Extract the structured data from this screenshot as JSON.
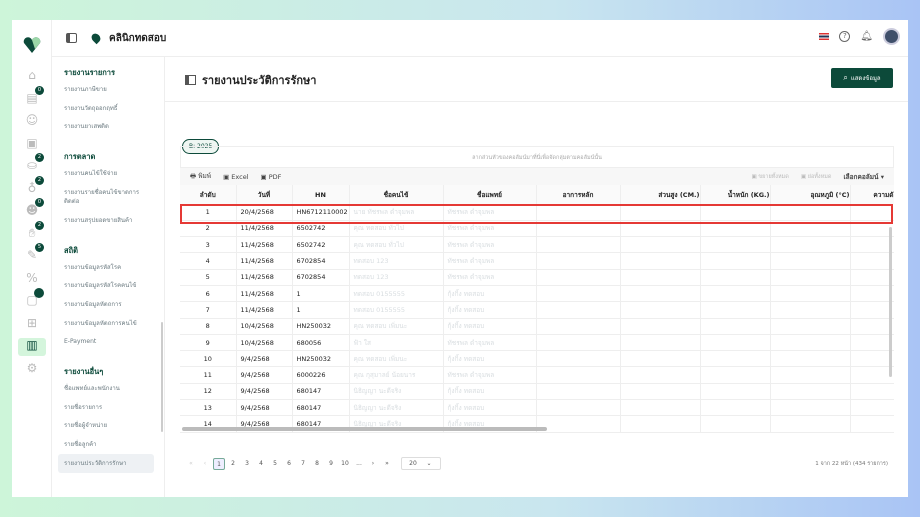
{
  "header": {
    "clinic_name": "คลินิกทดสอบ"
  },
  "rail": {
    "badges": [
      "0",
      "2",
      "2",
      "0",
      "2",
      "5"
    ]
  },
  "sidebar": {
    "groups": [
      {
        "title": "รายงานรายการ",
        "items": [
          "รายงานภาษีขาย",
          "รายงานวัตถุออกฤทธิ์",
          "รายงานยาเสพติด"
        ]
      },
      {
        "title": "การตลาด",
        "items": [
          "รายงานคนไข้ใช้จ่าย",
          "รายงานรายชื่อคนไข้ขาดการติดต่อ",
          "รายงานสรุปยอดขายสินค้า"
        ]
      },
      {
        "title": "สถิติ",
        "items": [
          "รายงานข้อมูลรหัสโรค",
          "รายงานข้อมูลรหัสโรคคนไข้",
          "รายงานข้อมูลหัตถการ",
          "รายงานข้อมูลหัตถการคนไข้",
          "E-Payment"
        ]
      },
      {
        "title": "รายงานอื่นๆ",
        "items": [
          "ชื่อแพทย์และพนักงาน",
          "รายชื่อรายการ",
          "รายชื่อผู้จำหน่าย",
          "รายชื่อลูกค้า",
          "รายงานประวัติการรักษา"
        ]
      }
    ]
  },
  "page": {
    "title": "รายงานประวัติการรักษา",
    "show_button": "แสดงข้อมูล",
    "filter_pill": "B: 2025",
    "group_hint": "ลากส่วนหัวของคอลัมน์มาที่นี่เพื่อจัดกลุ่มตามคอลัมน์นั้น"
  },
  "toolbar": {
    "print": "พิมพ์",
    "excel": "Excel",
    "pdf": "PDF",
    "expand_all": "ขยายทั้งหมด",
    "collapse_all": "ย่อทั้งหมด",
    "choose_columns": "เลือกคอลัมน์"
  },
  "table": {
    "columns": [
      "ลำดับ",
      "วันที่",
      "HN",
      "ชื่อคนไข้",
      "ชื่อแพทย์",
      "อาการหลัก",
      "ส่วนสูง (CM.)",
      "น้ำหนัก (KG.)",
      "อุณหภูมิ (°C)",
      "ความดั"
    ],
    "rows": [
      [
        "1",
        "20/4/2568",
        "HN6712110002",
        "นาย ทัชรพล ดำจุมพล",
        "ทัชรพล ดำจุมพล"
      ],
      [
        "2",
        "11/4/2568",
        "6502742",
        "คุณ ทดสอบ ทั่วไป",
        "ทัชรพล ดำจุมพล"
      ],
      [
        "3",
        "11/4/2568",
        "6502742",
        "คุณ ทดสอบ ทั่วไป",
        "ทัชรพล ดำจุมพล"
      ],
      [
        "4",
        "11/4/2568",
        "6702854",
        "ทดสอบ 123",
        "ทัชรพล ดำจุมพล"
      ],
      [
        "5",
        "11/4/2568",
        "6702854",
        "ทดสอบ 123",
        "ทัชรพล ดำจุมพล"
      ],
      [
        "6",
        "11/4/2568",
        "1",
        "ทดสอบ 0155555",
        "กุ้งกิ้ง ทดสอบ"
      ],
      [
        "7",
        "11/4/2568",
        "1",
        "ทดสอบ 0155555",
        "กุ้งกิ้ง ทดสอบ"
      ],
      [
        "8",
        "10/4/2568",
        "HN250032",
        "คุณ ทดสอบ เพิ่มนะ",
        "กุ้งกิ้ง ทดสอบ"
      ],
      [
        "9",
        "10/4/2568",
        "680056",
        "ฟ้า ใส",
        "ทัชรพล ดำจุมพล"
      ],
      [
        "10",
        "9/4/2568",
        "HN250032",
        "คุณ ทดสอบ เพิ่มนะ",
        "กุ้งกิ้ง ทดสอบ"
      ],
      [
        "11",
        "9/4/2568",
        "6000226",
        "คุณ กุสุมาลย์ น้อยนาร",
        "ทัชรพล ดำจุมพล"
      ],
      [
        "12",
        "9/4/2568",
        "680147",
        "นิธิญญา นะดีจริง",
        "กุ้งกิ้ง ทดสอบ"
      ],
      [
        "13",
        "9/4/2568",
        "680147",
        "นิธิญญา นะดีจริง",
        "กุ้งกิ้ง ทดสอบ"
      ],
      [
        "14",
        "9/4/2568",
        "680147",
        "นิธิญญา นะดีจริง",
        "กุ้งกิ้ง ทดสอบ"
      ]
    ]
  },
  "pager": {
    "pages": [
      "1",
      "2",
      "3",
      "4",
      "5",
      "6",
      "7",
      "8",
      "9",
      "10",
      "..."
    ],
    "page_size": "20",
    "info": "1 จาก 22 หน้า (434 รายการ)"
  }
}
